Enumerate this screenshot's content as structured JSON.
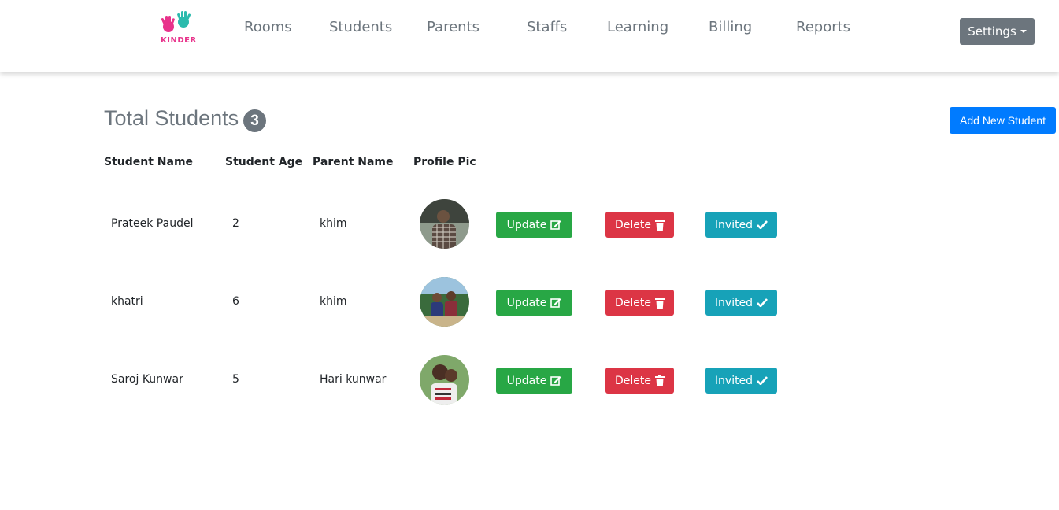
{
  "brand": {
    "logo_text": "KINDER"
  },
  "nav": {
    "items": [
      {
        "label": "Rooms"
      },
      {
        "label": "Students"
      },
      {
        "label": "Parents"
      },
      {
        "label": "Staffs"
      },
      {
        "label": "Learning"
      },
      {
        "label": "Billing"
      },
      {
        "label": "Reports"
      }
    ],
    "settings_label": "Settings"
  },
  "page": {
    "title": "Total Students",
    "count": "3",
    "add_button_label": "Add New Student"
  },
  "table": {
    "headers": [
      "Student Name",
      "Student Age",
      "Parent Name",
      "Profile Pic"
    ],
    "rows": [
      {
        "student_name": "Prateek Paudel",
        "age": "2",
        "parent_name": "khim"
      },
      {
        "student_name": "khatri",
        "age": "6",
        "parent_name": "khim"
      },
      {
        "student_name": "Saroj Kunwar",
        "age": "5",
        "parent_name": "Hari kunwar"
      }
    ],
    "actions": {
      "update_label": "Update",
      "delete_label": "Delete",
      "invited_label": "Invited"
    }
  },
  "colors": {
    "primary": "#007bff",
    "secondary": "#6c757d",
    "success": "#28a745",
    "danger": "#dc3545",
    "info": "#17a2b8",
    "brand_pink": "#e8338b",
    "brand_teal": "#2bbbad"
  },
  "icons": {
    "update": "edit-icon",
    "delete": "trash-icon",
    "invited": "check-icon",
    "settings": "caret-down-icon"
  }
}
